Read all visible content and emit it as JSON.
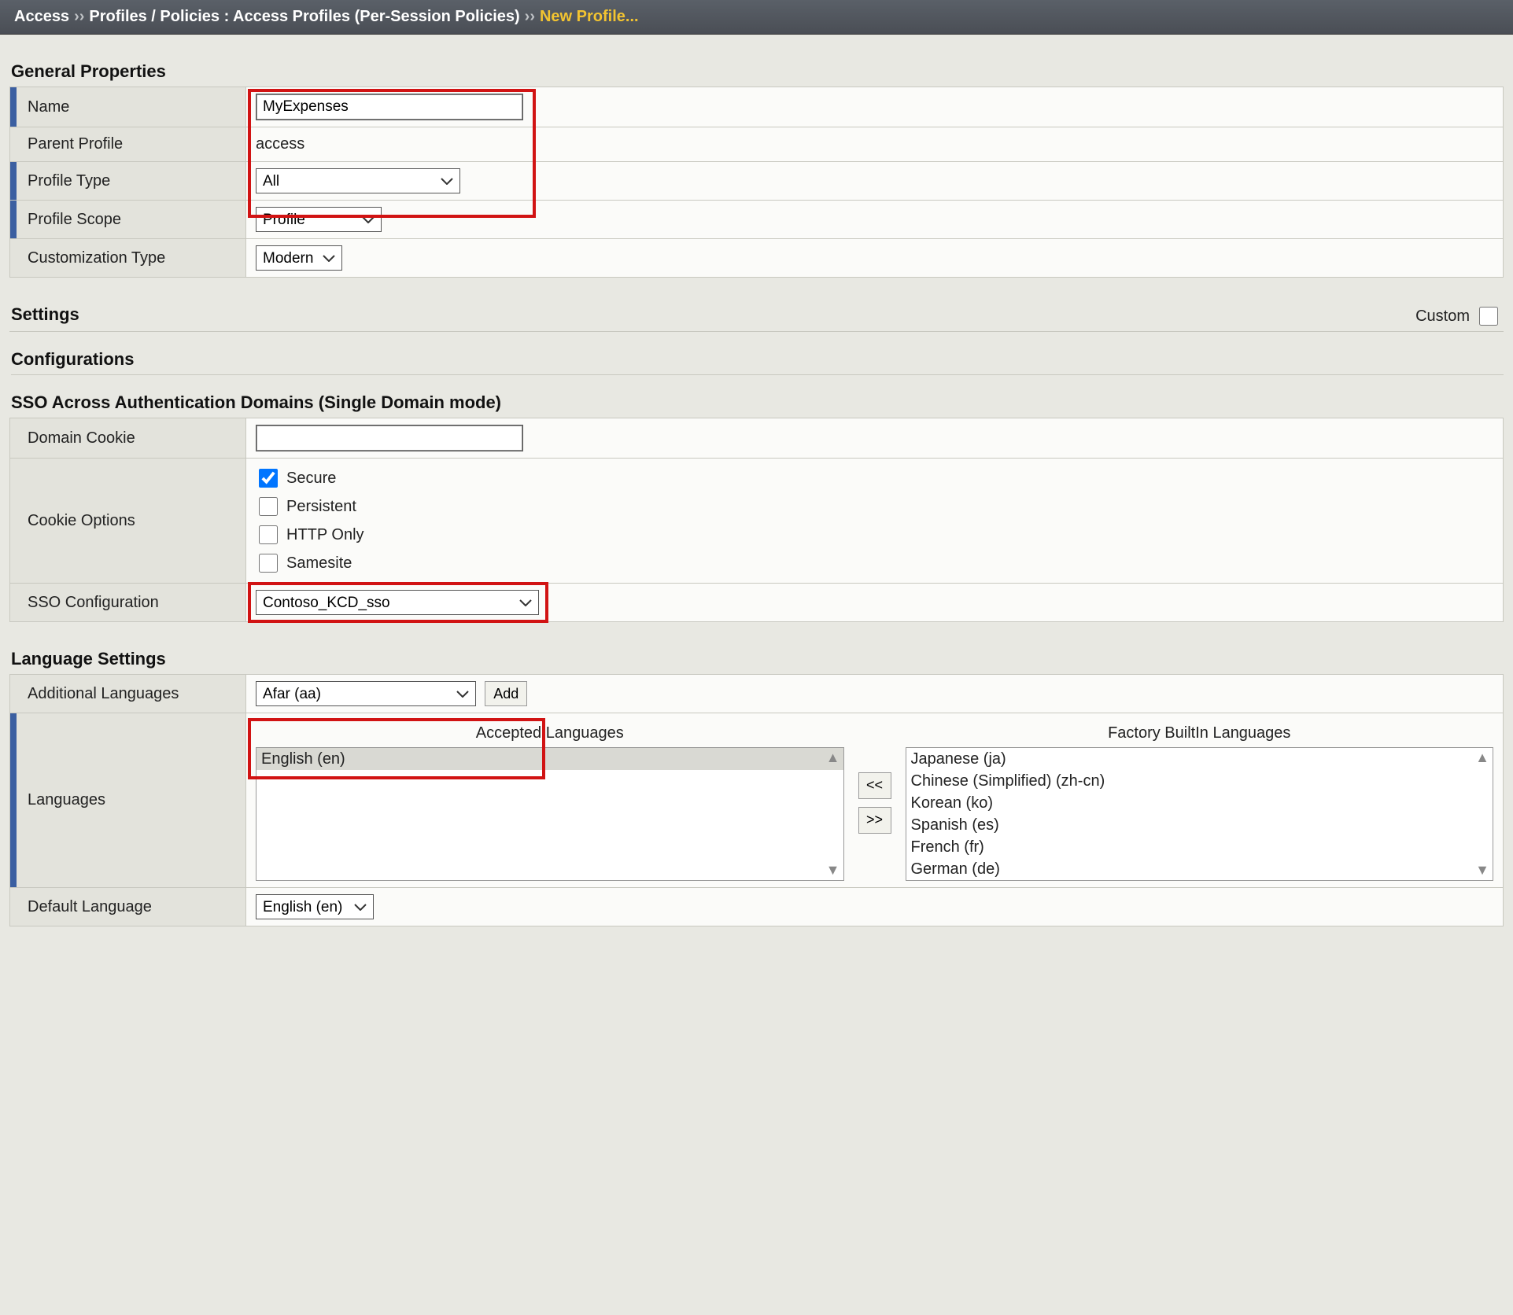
{
  "breadcrumb": {
    "root": "Access",
    "sep1": "››",
    "path": "Profiles / Policies : Access Profiles (Per-Session Policies)",
    "sep2": "››",
    "current": "New Profile..."
  },
  "sections": {
    "general": "General Properties",
    "settings": "Settings",
    "configurations": "Configurations",
    "sso_domains": "SSO Across Authentication Domains (Single Domain mode)",
    "language": "Language Settings"
  },
  "general": {
    "name": {
      "label": "Name",
      "value": "MyExpenses"
    },
    "parent_profile": {
      "label": "Parent Profile",
      "value": "access"
    },
    "profile_type": {
      "label": "Profile Type",
      "value": "All"
    },
    "profile_scope": {
      "label": "Profile Scope",
      "value": "Profile"
    },
    "customization_type": {
      "label": "Customization Type",
      "value": "Modern"
    }
  },
  "settings": {
    "custom_label": "Custom"
  },
  "sso": {
    "domain_cookie": {
      "label": "Domain Cookie",
      "value": ""
    },
    "cookie_options": {
      "label": "Cookie Options",
      "secure": "Secure",
      "persistent": "Persistent",
      "http_only": "HTTP Only",
      "samesite": "Samesite"
    },
    "sso_configuration": {
      "label": "SSO Configuration",
      "value": "Contoso_KCD_sso"
    }
  },
  "lang": {
    "additional": {
      "label": "Additional Languages",
      "value": "Afar (aa)",
      "add": "Add"
    },
    "languages_label": "Languages",
    "accepted_header": "Accepted Languages",
    "builtin_header": "Factory BuiltIn Languages",
    "accepted": [
      "English (en)"
    ],
    "builtin": [
      "Japanese (ja)",
      "Chinese (Simplified) (zh-cn)",
      "Korean (ko)",
      "Spanish (es)",
      "French (fr)",
      "German (de)"
    ],
    "move_left": "<<",
    "move_right": ">>",
    "default": {
      "label": "Default Language",
      "value": "English (en)"
    }
  }
}
